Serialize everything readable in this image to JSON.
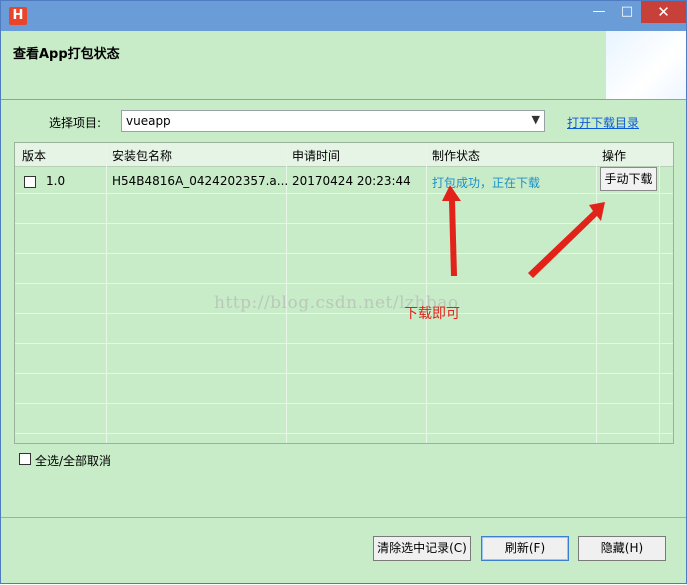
{
  "window": {
    "app_icon_letter": "H",
    "minimize_glyph": "—",
    "maximize_glyph": "□",
    "close_glyph": "✕"
  },
  "header": {
    "title": "查看App打包状态"
  },
  "project": {
    "label": "选择项目:",
    "selected": "vueapp",
    "open_dir_link": "打开下载目录"
  },
  "table": {
    "columns": [
      "版本",
      "安装包名称",
      "申请时间",
      "制作状态",
      "操作"
    ],
    "rows": [
      {
        "version": "1.0",
        "package_name": "H54B4816A_0424202357.a...",
        "request_time": "20170424 20:23:44",
        "status": "打包成功，正在下载",
        "action": "手动下载"
      }
    ]
  },
  "annotation": {
    "text": "下载即可"
  },
  "watermark": "http://blog.csdn.net/lzhbao",
  "select_all_label": "全选/全部取消",
  "buttons": {
    "clear": "清除选中记录(C)",
    "refresh": "刷新(F)",
    "hide": "隐藏(H)"
  },
  "colors": {
    "background": "#c8ebc8",
    "link": "#0b5bd6",
    "status": "#1e90c8",
    "annotation": "#e2231a",
    "titlebar": "#6a9cd8"
  }
}
